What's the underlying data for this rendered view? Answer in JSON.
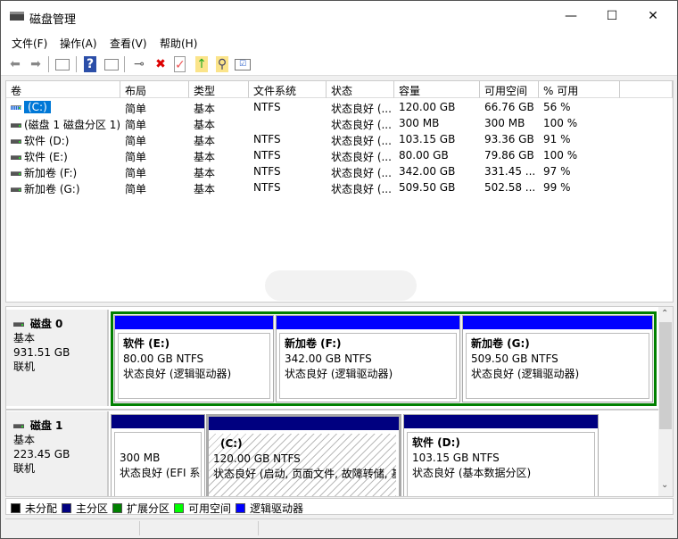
{
  "window": {
    "title": "磁盘管理",
    "minimize": "—",
    "maximize": "☐",
    "close": "✕"
  },
  "menu": [
    "文件(F)",
    "操作(A)",
    "查看(V)",
    "帮助(H)"
  ],
  "toolbar": {
    "icons": [
      "back-icon",
      "forward-icon",
      "console-tree-icon",
      "help-icon",
      "action-pane-icon",
      "connect-disk-icon",
      "delete-icon",
      "properties-icon",
      "export-icon",
      "search-icon",
      "checklist-icon"
    ]
  },
  "columns": [
    "卷",
    "布局",
    "类型",
    "文件系统",
    "状态",
    "容量",
    "可用空间",
    "% 可用"
  ],
  "volumes": [
    {
      "name": "(C:)",
      "layout": "简单",
      "type": "基本",
      "fs": "NTFS",
      "status": "状态良好 (...",
      "capacity": "120.00 GB",
      "free": "66.76 GB",
      "pct": "56 %"
    },
    {
      "name": "(磁盘 1 磁盘分区 1)",
      "layout": "简单",
      "type": "基本",
      "fs": "",
      "status": "状态良好 (...",
      "capacity": "300 MB",
      "free": "300 MB",
      "pct": "100 %"
    },
    {
      "name": "软件 (D:)",
      "layout": "简单",
      "type": "基本",
      "fs": "NTFS",
      "status": "状态良好 (...",
      "capacity": "103.15 GB",
      "free": "93.36 GB",
      "pct": "91 %"
    },
    {
      "name": "软件 (E:)",
      "layout": "简单",
      "type": "基本",
      "fs": "NTFS",
      "status": "状态良好 (...",
      "capacity": "80.00 GB",
      "free": "79.86 GB",
      "pct": "100 %"
    },
    {
      "name": "新加卷 (F:)",
      "layout": "简单",
      "type": "基本",
      "fs": "NTFS",
      "status": "状态良好 (...",
      "capacity": "342.00 GB",
      "free": "331.45 ...",
      "pct": "97 %"
    },
    {
      "name": "新加卷 (G:)",
      "layout": "简单",
      "type": "基本",
      "fs": "NTFS",
      "status": "状态良好 (...",
      "capacity": "509.50 GB",
      "free": "502.58 ...",
      "pct": "99 %"
    }
  ],
  "disks": [
    {
      "name": "磁盘 0",
      "type": "基本",
      "size": "931.51 GB",
      "state": "联机",
      "partitions": [
        {
          "title": "软件  (E:)",
          "size": "80.00 GB NTFS",
          "status": "状态良好 (逻辑驱动器)"
        },
        {
          "title": "新加卷  (F:)",
          "size": "342.00 GB NTFS",
          "status": "状态良好 (逻辑驱动器)"
        },
        {
          "title": "新加卷  (G:)",
          "size": "509.50 GB NTFS",
          "status": "状态良好 (逻辑驱动器)"
        }
      ]
    },
    {
      "name": "磁盘 1",
      "type": "基本",
      "size": "223.45 GB",
      "state": "联机",
      "partitions": [
        {
          "title": "",
          "size": "300 MB",
          "status": "状态良好 (EFI 系统分区)"
        },
        {
          "title": "(C:)",
          "size": "120.00 GB NTFS",
          "status": "状态良好 (启动, 页面文件, 故障转储, 基本数据分区)"
        },
        {
          "title": "软件  (D:)",
          "size": "103.15 GB NTFS",
          "status": "状态良好 (基本数据分区)"
        }
      ]
    }
  ],
  "legend": [
    {
      "label": "未分配",
      "color": "#000000"
    },
    {
      "label": "主分区",
      "color": "#000080"
    },
    {
      "label": "扩展分区",
      "color": "#008000"
    },
    {
      "label": "可用空间",
      "color": "#00ff00"
    },
    {
      "label": "逻辑驱动器",
      "color": "#0000ff"
    }
  ],
  "colors": {
    "logical": "#0000ff",
    "primary": "#000080",
    "extended": "#008000"
  }
}
